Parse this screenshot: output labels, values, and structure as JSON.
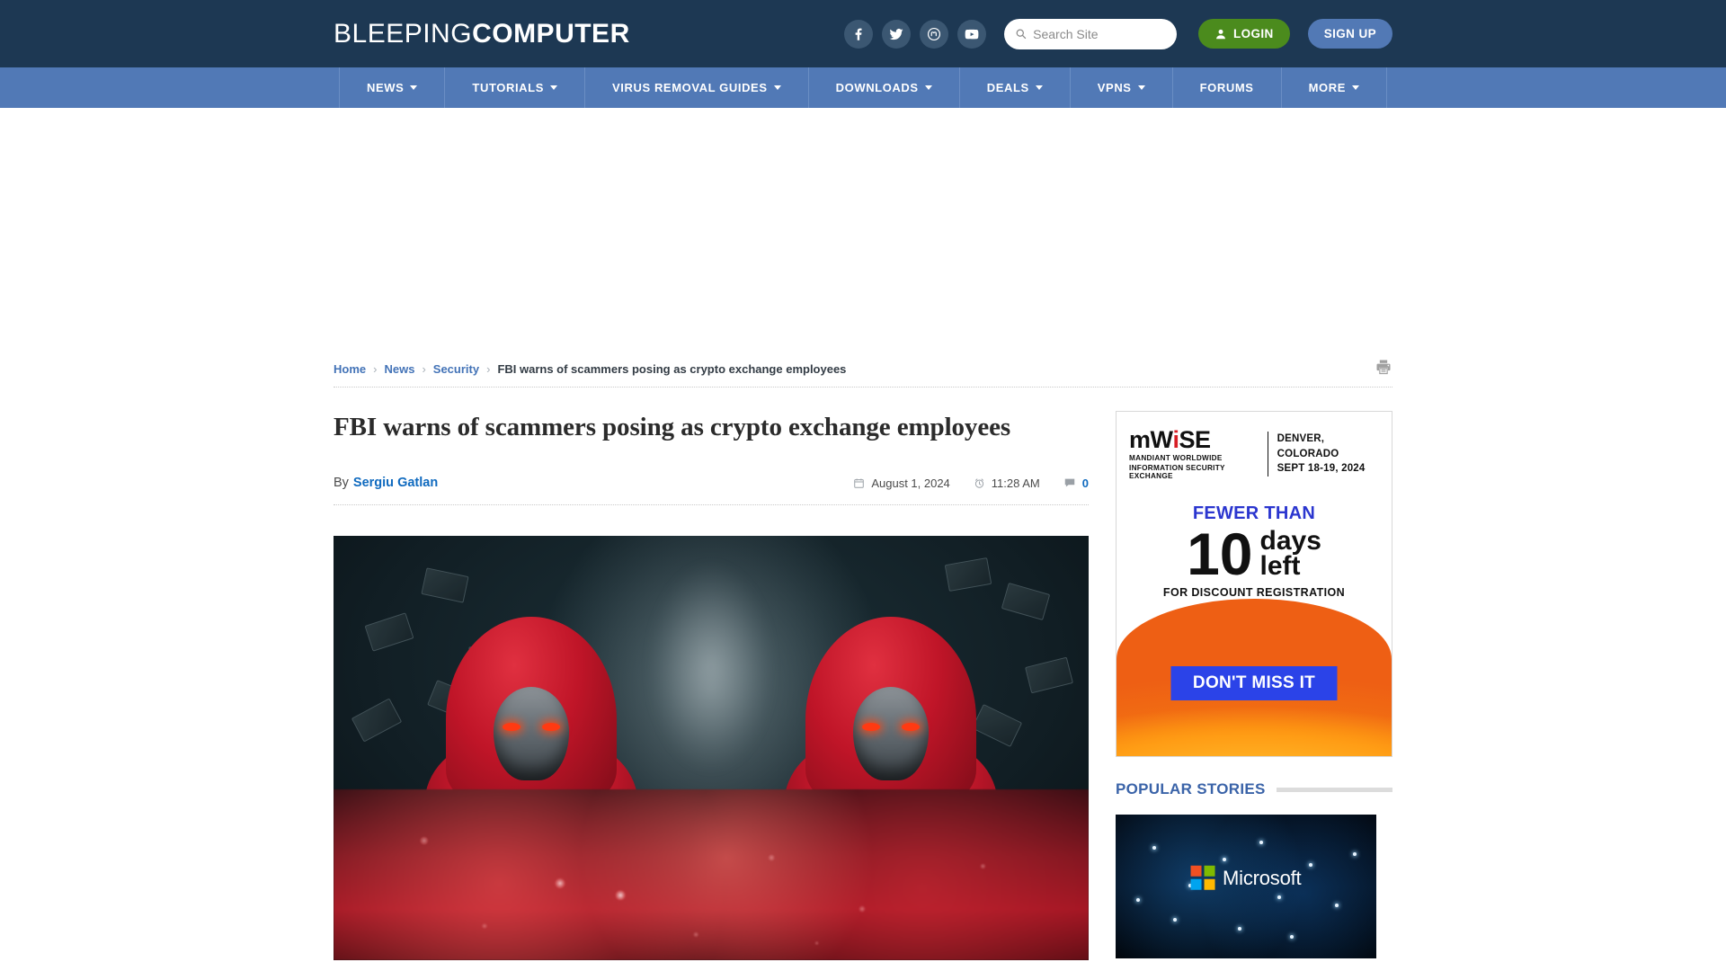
{
  "site": {
    "logo_thin": "BLEEPING",
    "logo_bold": "COMPUTER",
    "brand_navy": "#1d3853",
    "brand_blue": "#5179b6",
    "login_green": "#4b8b1d"
  },
  "header": {
    "social": [
      {
        "name": "facebook-icon",
        "label": "Facebook"
      },
      {
        "name": "twitter-icon",
        "label": "Twitter"
      },
      {
        "name": "mastodon-icon",
        "label": "Mastodon"
      },
      {
        "name": "youtube-icon",
        "label": "YouTube"
      }
    ],
    "search": {
      "placeholder": "Search Site",
      "value": ""
    },
    "login_label": "LOGIN",
    "signup_label": "SIGN UP"
  },
  "nav": {
    "items": [
      {
        "label": "NEWS",
        "has_dropdown": true
      },
      {
        "label": "TUTORIALS",
        "has_dropdown": true
      },
      {
        "label": "VIRUS REMOVAL GUIDES",
        "has_dropdown": true
      },
      {
        "label": "DOWNLOADS",
        "has_dropdown": true
      },
      {
        "label": "DEALS",
        "has_dropdown": true
      },
      {
        "label": "VPNS",
        "has_dropdown": true
      },
      {
        "label": "FORUMS",
        "has_dropdown": false
      },
      {
        "label": "MORE",
        "has_dropdown": true
      }
    ]
  },
  "breadcrumb": {
    "home": "Home",
    "news": "News",
    "security": "Security",
    "current": "FBI warns of scammers posing as crypto exchange employees",
    "separator": "›"
  },
  "article": {
    "title": "FBI warns of scammers posing as crypto exchange employees",
    "by_label": "By",
    "author": "Sergiu Gatlan",
    "date": "August 1, 2024",
    "time": "11:28 AM",
    "comment_count": "0"
  },
  "sidebar": {
    "ad": {
      "logo_m": "m",
      "logo_w": "W",
      "logo_i": "i",
      "logo_se": "SE",
      "sub_line1": "MANDIANT WORLDWIDE",
      "sub_line2": "INFORMATION SECURITY EXCHANGE",
      "location": "DENVER, COLORADO",
      "dates": "SEPT 18-19, 2024",
      "fewer_than": "FEWER THAN",
      "number": "10",
      "days": "days",
      "left": "left",
      "discount": "FOR DISCOUNT REGISTRATION",
      "cta": "DON'T MISS IT",
      "accent_blue": "#2b43e8",
      "accent_orange": "#ff8c00"
    },
    "popular": {
      "heading": "POPULAR STORIES",
      "thumb_brand": "Microsoft"
    }
  }
}
